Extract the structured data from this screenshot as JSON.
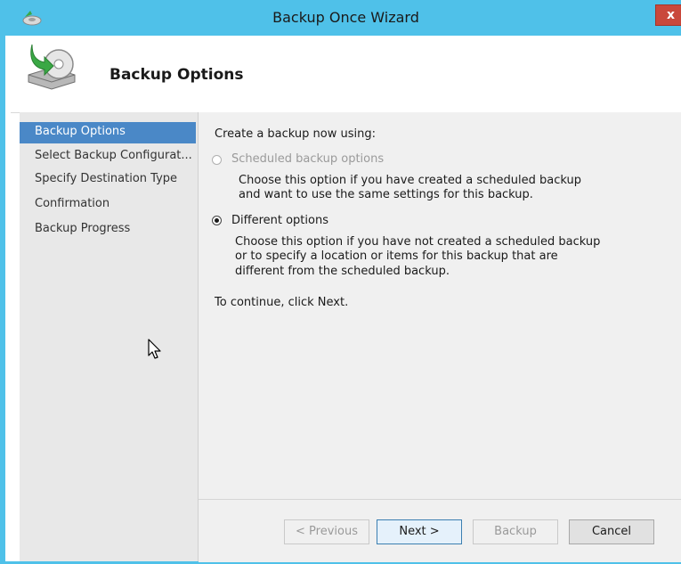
{
  "window": {
    "title": "Backup Once Wizard",
    "close_label": "x",
    "accent_color": "#4fc1e9",
    "title_icon": "backup-app-icon"
  },
  "header": {
    "title": "Backup Options",
    "icon": "backup-disk-icon"
  },
  "nav": {
    "items": [
      {
        "label": "Backup Options",
        "active": true
      },
      {
        "label": "Select Backup Configurat...",
        "active": false
      },
      {
        "label": "Specify Destination Type",
        "active": false
      },
      {
        "label": "Confirmation",
        "active": false
      },
      {
        "label": "Backup Progress",
        "active": false
      }
    ],
    "active_color": "#4a88c7"
  },
  "content": {
    "intro": "Create a backup now using:",
    "option1": {
      "label": "Scheduled backup options",
      "enabled": false,
      "selected": false,
      "desc_line1": "Choose this option if you have created a scheduled backup",
      "desc_line2": "and want to use the same settings for this backup."
    },
    "option2": {
      "label": "Different options",
      "enabled": true,
      "selected": true,
      "desc_line1": "Choose this option if you have not created a scheduled backup",
      "desc_line2": "or to specify a location or items for this backup that are",
      "desc_line3": "different from the scheduled backup."
    },
    "continue_text": "To continue, click Next."
  },
  "buttons": {
    "previous": {
      "label": "< Previous",
      "enabled": false
    },
    "next": {
      "label": "Next >",
      "enabled": true
    },
    "backup": {
      "label": "Backup",
      "enabled": false
    },
    "cancel": {
      "label": "Cancel",
      "enabled": true
    }
  }
}
